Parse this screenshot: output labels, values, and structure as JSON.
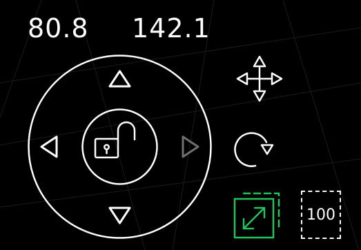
{
  "readout": {
    "x_value": "80.8",
    "y_value": "142.1"
  },
  "controls": {
    "zoom_label": "100",
    "lock_state": "unlocked",
    "right_arrow_state": "disabled"
  },
  "icons": {
    "up": "up-arrow-icon",
    "down": "down-arrow-icon",
    "left": "left-arrow-icon",
    "right": "right-arrow-icon",
    "lock": "unlock-icon",
    "move": "move-icon",
    "rotate": "rotate-icon",
    "resize": "resize-icon"
  },
  "colors": {
    "background": "#000000",
    "foreground": "#ffffff",
    "disabled": "#707070",
    "accent_green": "#22c55e"
  }
}
